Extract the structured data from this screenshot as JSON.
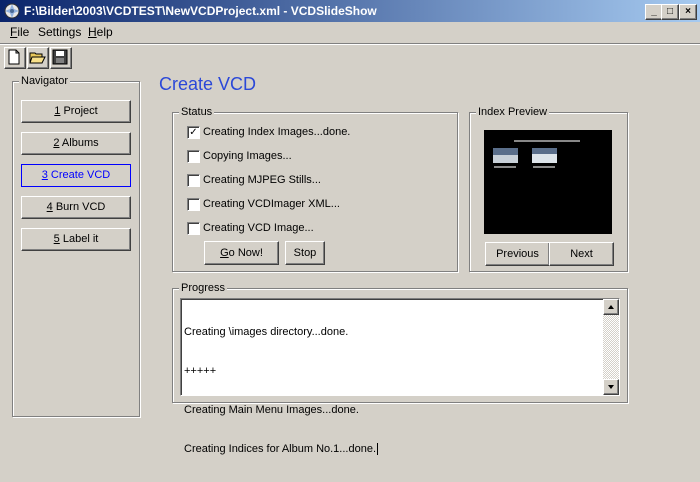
{
  "window": {
    "title": "F:\\Bilder\\2003\\VCDTEST\\NewVCDProject.xml - VCDSlideShow",
    "minimize_glyph": "_",
    "maximize_glyph": "□",
    "close_glyph": "×"
  },
  "menu": [
    {
      "u": "F",
      "rest": "ile"
    },
    {
      "u": "",
      "rest": "Settings"
    },
    {
      "u": "H",
      "rest": "elp"
    }
  ],
  "navigator": {
    "label": "Navigator",
    "items": [
      {
        "u": "1",
        "rest": " Project",
        "active": false
      },
      {
        "u": "2",
        "rest": " Albums",
        "active": false
      },
      {
        "u": "3",
        "rest": " Create VCD",
        "active": true
      },
      {
        "u": "4",
        "rest": " Burn VCD",
        "active": false
      },
      {
        "u": "5",
        "rest": " Label it",
        "active": false
      }
    ]
  },
  "page": {
    "title": "Create VCD"
  },
  "status": {
    "label": "Status",
    "items": [
      {
        "label": "Creating Index Images...done.",
        "checked": true
      },
      {
        "label": "Copying Images...",
        "checked": false
      },
      {
        "label": "Creating MJPEG Stills...",
        "checked": false
      },
      {
        "label": "Creating VCDImager XML...",
        "checked": false
      },
      {
        "label": "Creating VCD Image...",
        "checked": false
      }
    ],
    "go_u": "G",
    "go_rest": "o Now!",
    "stop_label": "Stop",
    "check_glyph": "✓"
  },
  "preview": {
    "label": "Index Preview",
    "previous_label": "Previous",
    "next_label": "Next"
  },
  "progress": {
    "label": "Progress",
    "lines": [
      "Creating \\images directory...done.",
      "+++++",
      "Creating Main Menu Images...done.",
      "Creating Indices for Album No.1...done."
    ]
  },
  "colors": {
    "title_bar_start": "#0a246a",
    "title_bar_end": "#a6caf0",
    "accent": "#2b48d8",
    "active_nav": "#0000ff"
  }
}
